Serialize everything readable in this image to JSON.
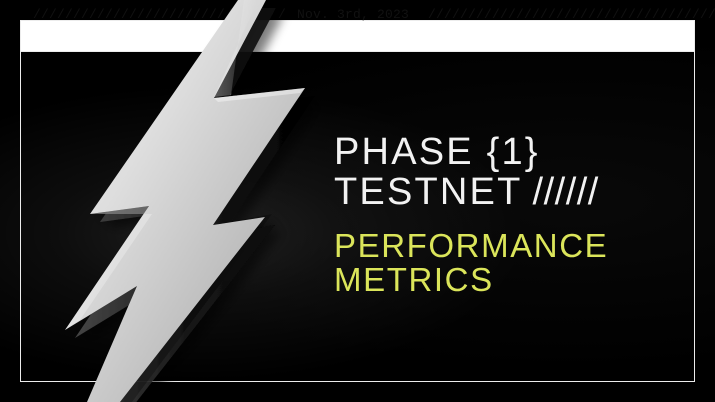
{
  "header": {
    "left_slashes": "////////////////////////////",
    "separator": "/",
    "date": "Nov. 3rd, 2023",
    "right_slashes": "//////////////////////////////////////"
  },
  "headline": {
    "line1": "PHASE {1}",
    "line2_main": "TESTNET",
    "line2_slashes": "//////",
    "line3": "PERFORMANCE",
    "line4": "METRICS"
  },
  "colors": {
    "background": "#000000",
    "header_bar": "#ffffff",
    "headline_primary": "#f2f2f2",
    "headline_accent": "#dbe55a",
    "frame": "#ececec"
  },
  "icons": {
    "hero_graphic": "lightning-bolt-icon"
  }
}
